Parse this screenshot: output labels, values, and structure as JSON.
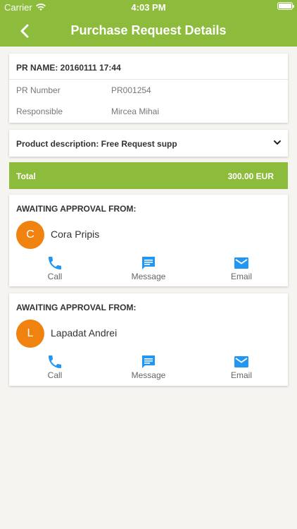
{
  "status_bar": {
    "carrier": "Carrier",
    "time": "4:03 PM"
  },
  "nav": {
    "title": "Purchase Request Details"
  },
  "pr": {
    "name": "PR NAME: 20160111 17:44",
    "number_label": "PR Number",
    "number_value": "PR001254",
    "responsible_label": "Responsible",
    "responsible_value": "Mircea Mihai"
  },
  "product": {
    "description": "Product description: Free Request supp"
  },
  "total": {
    "label": "Total",
    "value": "300.00 EUR"
  },
  "approvals": [
    {
      "title": "AWAITING APPROVAL FROM:",
      "initial": "C",
      "name": "Cora Pripis"
    },
    {
      "title": "AWAITING APPROVAL FROM:",
      "initial": "L",
      "name": "Lapadat Andrei"
    }
  ],
  "actions": {
    "call": "Call",
    "message": "Message",
    "email": "Email"
  },
  "colors": {
    "brand_green": "#8dbb3b",
    "avatar_orange": "#f0820f",
    "action_blue": "#2196f3"
  },
  "icons": [
    "wifi-icon",
    "battery-icon",
    "back-chevron-icon",
    "chevron-down-icon",
    "phone-icon",
    "message-icon",
    "email-icon"
  ]
}
